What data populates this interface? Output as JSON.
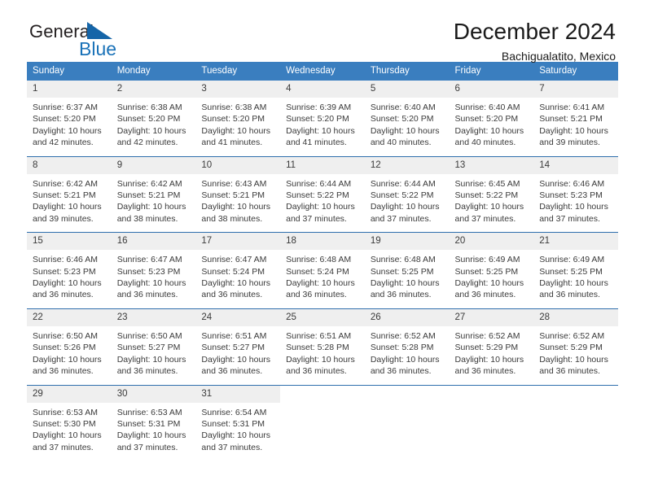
{
  "brand": {
    "name_part1": "General",
    "name_part2": "Blue",
    "triangle_color": "#1565a8",
    "blue_color": "#1a72b8"
  },
  "header": {
    "title": "December 2024",
    "subtitle": "Bachigualatito, Mexico"
  },
  "theme": {
    "header_row_bg": "#3a7ebf",
    "header_row_text": "#ffffff",
    "daynum_bg": "#efefef",
    "row_divider": "#2f6fad"
  },
  "weekdays": [
    "Sunday",
    "Monday",
    "Tuesday",
    "Wednesday",
    "Thursday",
    "Friday",
    "Saturday"
  ],
  "weeks": [
    [
      {
        "day": "1",
        "sunrise": "Sunrise: 6:37 AM",
        "sunset": "Sunset: 5:20 PM",
        "daylight": "Daylight: 10 hours and 42 minutes."
      },
      {
        "day": "2",
        "sunrise": "Sunrise: 6:38 AM",
        "sunset": "Sunset: 5:20 PM",
        "daylight": "Daylight: 10 hours and 42 minutes."
      },
      {
        "day": "3",
        "sunrise": "Sunrise: 6:38 AM",
        "sunset": "Sunset: 5:20 PM",
        "daylight": "Daylight: 10 hours and 41 minutes."
      },
      {
        "day": "4",
        "sunrise": "Sunrise: 6:39 AM",
        "sunset": "Sunset: 5:20 PM",
        "daylight": "Daylight: 10 hours and 41 minutes."
      },
      {
        "day": "5",
        "sunrise": "Sunrise: 6:40 AM",
        "sunset": "Sunset: 5:20 PM",
        "daylight": "Daylight: 10 hours and 40 minutes."
      },
      {
        "day": "6",
        "sunrise": "Sunrise: 6:40 AM",
        "sunset": "Sunset: 5:20 PM",
        "daylight": "Daylight: 10 hours and 40 minutes."
      },
      {
        "day": "7",
        "sunrise": "Sunrise: 6:41 AM",
        "sunset": "Sunset: 5:21 PM",
        "daylight": "Daylight: 10 hours and 39 minutes."
      }
    ],
    [
      {
        "day": "8",
        "sunrise": "Sunrise: 6:42 AM",
        "sunset": "Sunset: 5:21 PM",
        "daylight": "Daylight: 10 hours and 39 minutes."
      },
      {
        "day": "9",
        "sunrise": "Sunrise: 6:42 AM",
        "sunset": "Sunset: 5:21 PM",
        "daylight": "Daylight: 10 hours and 38 minutes."
      },
      {
        "day": "10",
        "sunrise": "Sunrise: 6:43 AM",
        "sunset": "Sunset: 5:21 PM",
        "daylight": "Daylight: 10 hours and 38 minutes."
      },
      {
        "day": "11",
        "sunrise": "Sunrise: 6:44 AM",
        "sunset": "Sunset: 5:22 PM",
        "daylight": "Daylight: 10 hours and 37 minutes."
      },
      {
        "day": "12",
        "sunrise": "Sunrise: 6:44 AM",
        "sunset": "Sunset: 5:22 PM",
        "daylight": "Daylight: 10 hours and 37 minutes."
      },
      {
        "day": "13",
        "sunrise": "Sunrise: 6:45 AM",
        "sunset": "Sunset: 5:22 PM",
        "daylight": "Daylight: 10 hours and 37 minutes."
      },
      {
        "day": "14",
        "sunrise": "Sunrise: 6:46 AM",
        "sunset": "Sunset: 5:23 PM",
        "daylight": "Daylight: 10 hours and 37 minutes."
      }
    ],
    [
      {
        "day": "15",
        "sunrise": "Sunrise: 6:46 AM",
        "sunset": "Sunset: 5:23 PM",
        "daylight": "Daylight: 10 hours and 36 minutes."
      },
      {
        "day": "16",
        "sunrise": "Sunrise: 6:47 AM",
        "sunset": "Sunset: 5:23 PM",
        "daylight": "Daylight: 10 hours and 36 minutes."
      },
      {
        "day": "17",
        "sunrise": "Sunrise: 6:47 AM",
        "sunset": "Sunset: 5:24 PM",
        "daylight": "Daylight: 10 hours and 36 minutes."
      },
      {
        "day": "18",
        "sunrise": "Sunrise: 6:48 AM",
        "sunset": "Sunset: 5:24 PM",
        "daylight": "Daylight: 10 hours and 36 minutes."
      },
      {
        "day": "19",
        "sunrise": "Sunrise: 6:48 AM",
        "sunset": "Sunset: 5:25 PM",
        "daylight": "Daylight: 10 hours and 36 minutes."
      },
      {
        "day": "20",
        "sunrise": "Sunrise: 6:49 AM",
        "sunset": "Sunset: 5:25 PM",
        "daylight": "Daylight: 10 hours and 36 minutes."
      },
      {
        "day": "21",
        "sunrise": "Sunrise: 6:49 AM",
        "sunset": "Sunset: 5:25 PM",
        "daylight": "Daylight: 10 hours and 36 minutes."
      }
    ],
    [
      {
        "day": "22",
        "sunrise": "Sunrise: 6:50 AM",
        "sunset": "Sunset: 5:26 PM",
        "daylight": "Daylight: 10 hours and 36 minutes."
      },
      {
        "day": "23",
        "sunrise": "Sunrise: 6:50 AM",
        "sunset": "Sunset: 5:27 PM",
        "daylight": "Daylight: 10 hours and 36 minutes."
      },
      {
        "day": "24",
        "sunrise": "Sunrise: 6:51 AM",
        "sunset": "Sunset: 5:27 PM",
        "daylight": "Daylight: 10 hours and 36 minutes."
      },
      {
        "day": "25",
        "sunrise": "Sunrise: 6:51 AM",
        "sunset": "Sunset: 5:28 PM",
        "daylight": "Daylight: 10 hours and 36 minutes."
      },
      {
        "day": "26",
        "sunrise": "Sunrise: 6:52 AM",
        "sunset": "Sunset: 5:28 PM",
        "daylight": "Daylight: 10 hours and 36 minutes."
      },
      {
        "day": "27",
        "sunrise": "Sunrise: 6:52 AM",
        "sunset": "Sunset: 5:29 PM",
        "daylight": "Daylight: 10 hours and 36 minutes."
      },
      {
        "day": "28",
        "sunrise": "Sunrise: 6:52 AM",
        "sunset": "Sunset: 5:29 PM",
        "daylight": "Daylight: 10 hours and 36 minutes."
      }
    ],
    [
      {
        "day": "29",
        "sunrise": "Sunrise: 6:53 AM",
        "sunset": "Sunset: 5:30 PM",
        "daylight": "Daylight: 10 hours and 37 minutes."
      },
      {
        "day": "30",
        "sunrise": "Sunrise: 6:53 AM",
        "sunset": "Sunset: 5:31 PM",
        "daylight": "Daylight: 10 hours and 37 minutes."
      },
      {
        "day": "31",
        "sunrise": "Sunrise: 6:54 AM",
        "sunset": "Sunset: 5:31 PM",
        "daylight": "Daylight: 10 hours and 37 minutes."
      },
      {
        "day": "",
        "sunrise": "",
        "sunset": "",
        "daylight": ""
      },
      {
        "day": "",
        "sunrise": "",
        "sunset": "",
        "daylight": ""
      },
      {
        "day": "",
        "sunrise": "",
        "sunset": "",
        "daylight": ""
      },
      {
        "day": "",
        "sunrise": "",
        "sunset": "",
        "daylight": ""
      }
    ]
  ]
}
